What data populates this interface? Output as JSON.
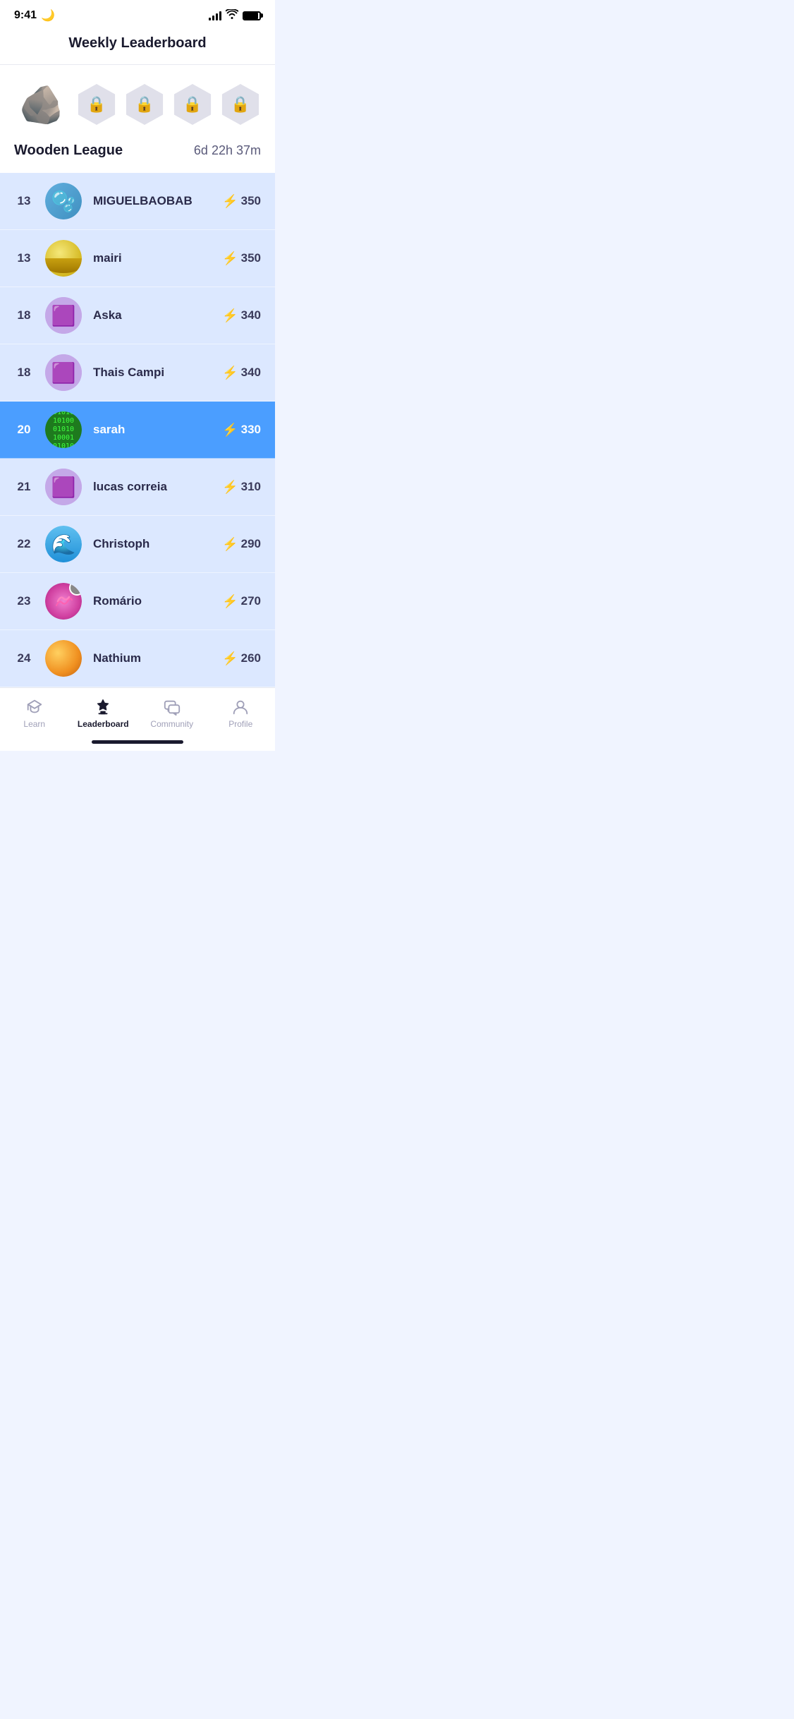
{
  "statusBar": {
    "time": "9:41",
    "moonIcon": "🌙"
  },
  "header": {
    "title": "Weekly Leaderboard"
  },
  "league": {
    "name": "Wooden League",
    "timer": "6d 22h 37m",
    "activeBadge": "🪨",
    "lockedBadges": [
      "🔒",
      "🔒",
      "🔒",
      "🔒"
    ]
  },
  "leaderboard": [
    {
      "rank": "13",
      "username": "MIGUELBAOBAB",
      "score": "350",
      "avatarType": "miguelbaobab",
      "isCurrentUser": false
    },
    {
      "rank": "13",
      "username": "mairi",
      "score": "350",
      "avatarType": "mairi",
      "isCurrentUser": false
    },
    {
      "rank": "18",
      "username": "Aska",
      "score": "340",
      "avatarType": "aska",
      "isCurrentUser": false
    },
    {
      "rank": "18",
      "username": "Thais Campi",
      "score": "340",
      "avatarType": "thais",
      "isCurrentUser": false
    },
    {
      "rank": "20",
      "username": "sarah",
      "score": "330",
      "avatarType": "sarah",
      "isCurrentUser": true
    },
    {
      "rank": "21",
      "username": "lucas correia",
      "score": "310",
      "avatarType": "lucas",
      "isCurrentUser": false
    },
    {
      "rank": "22",
      "username": "Christoph",
      "score": "290",
      "avatarType": "christoph",
      "isCurrentUser": false
    },
    {
      "rank": "23",
      "username": "Romário",
      "score": "270",
      "avatarType": "romario",
      "isCurrentUser": false,
      "hasNotification": true
    },
    {
      "rank": "24",
      "username": "Nathium",
      "score": "260",
      "avatarType": "nathium",
      "isCurrentUser": false
    }
  ],
  "bottomNav": {
    "items": [
      {
        "id": "learn",
        "label": "Learn",
        "active": false
      },
      {
        "id": "leaderboard",
        "label": "Leaderboard",
        "active": true
      },
      {
        "id": "community",
        "label": "Community",
        "active": false
      },
      {
        "id": "profile",
        "label": "Profile",
        "active": false
      }
    ]
  }
}
